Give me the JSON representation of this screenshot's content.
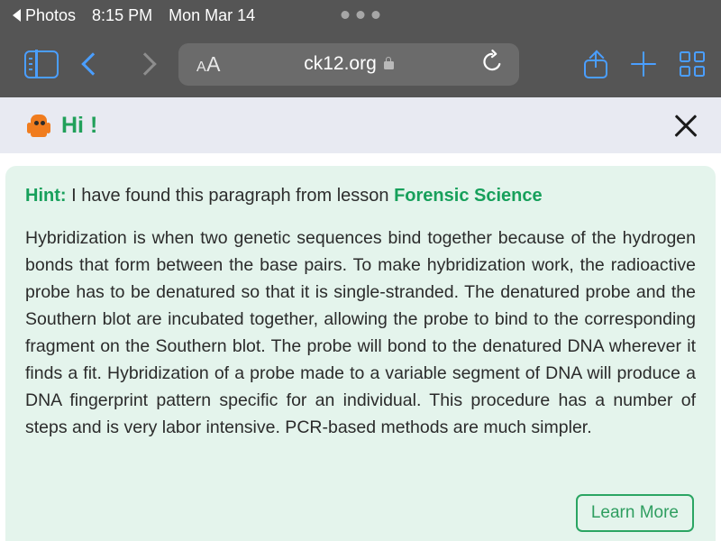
{
  "status_bar": {
    "back_app_label": "Photos",
    "time": "8:15 PM",
    "date": "Mon Mar 14",
    "back_icon": "triangle-left-icon",
    "multitask_icon": "three-dots-icon"
  },
  "browser": {
    "sidebar_icon": "sidebar-toggle-icon",
    "back_icon": "chevron-left-icon",
    "forward_icon": "chevron-right-icon",
    "text_size_small": "A",
    "text_size_large": "A",
    "url": "ck12.org",
    "lock_icon": "lock-icon",
    "reload_icon": "reload-icon",
    "share_icon": "share-icon",
    "new_tab_icon": "plus-icon",
    "tabs_icon": "tabs-grid-icon"
  },
  "greeting": {
    "mascot_icon": "ck12-mascot-icon",
    "text": "Hi !",
    "close_icon": "close-icon"
  },
  "card": {
    "hint_label": "Hint:",
    "hint_text": " I have found this paragraph from lesson ",
    "lesson_name": "Forensic Science",
    "paragraph": "Hybridization is when two genetic sequences bind together because of the hydrogen bonds that form between the base pairs. To make hybridization work, the radioactive probe has to be denatured so that it is single-stranded. The denatured probe and the Southern blot are incubated together, allowing the probe to bind to the corresponding fragment on the Southern blot. The probe will bond to the denatured DNA wherever it finds a fit. Hybridization of a probe made to a variable segment of DNA will produce a DNA fingerprint pattern specific for an individual. This procedure has a number of steps and is very labor intensive. PCR-based methods are much simpler.",
    "learn_more_label": "Learn More"
  },
  "colors": {
    "chrome": "#555555",
    "accent_blue": "#4a9eff",
    "greet_bar": "#e8eaf2",
    "brand_green": "#17a05b",
    "card_bg": "#e4f4ec",
    "mascot_orange": "#f07c1e"
  }
}
